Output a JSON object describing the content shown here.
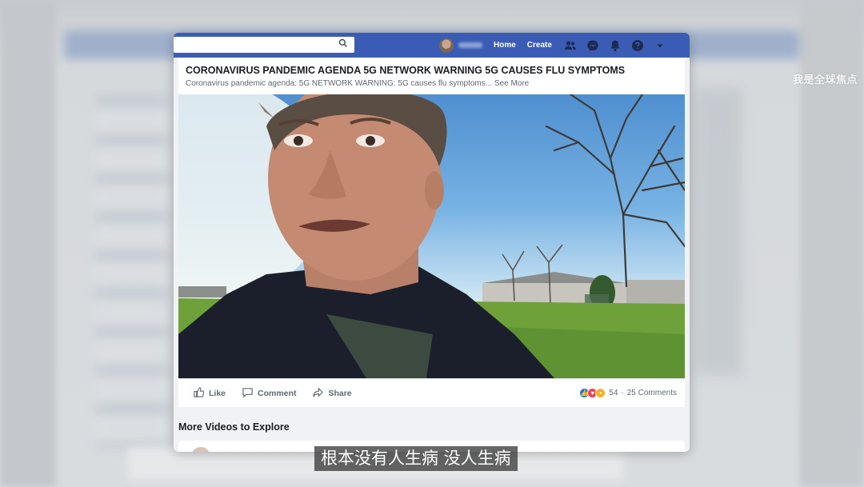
{
  "navbar": {
    "search_placeholder": "",
    "home_label": "Home",
    "create_label": "Create"
  },
  "post": {
    "title": "CORONAVIRUS PANDEMIC AGENDA 5G NETWORK WARNING 5G CAUSES FLU SYMPTOMS",
    "description": "Coronavirus pandemic agenda: 5G NETWORK WARNING: 5G causes flu symptoms...",
    "see_more": "See More",
    "actions": {
      "like": "Like",
      "comment": "Comment",
      "share": "Share"
    },
    "reaction_count": "54",
    "separator": "·",
    "comments": "25 Comments"
  },
  "more_videos_title": "More Videos to Explore",
  "subtitle": "根本没有人生病 没人生病",
  "watermark": "我是全球焦点",
  "icons": [
    "search-icon",
    "friends-icon",
    "messenger-icon",
    "bell-icon",
    "help-icon",
    "caret-down-icon",
    "like-icon",
    "comment-icon",
    "share-icon"
  ],
  "colors": {
    "nav_blue": "#3b5cb5",
    "like_blue": "#1877f2",
    "love_red": "#f33e58",
    "wow_yellow": "#f7b125"
  }
}
